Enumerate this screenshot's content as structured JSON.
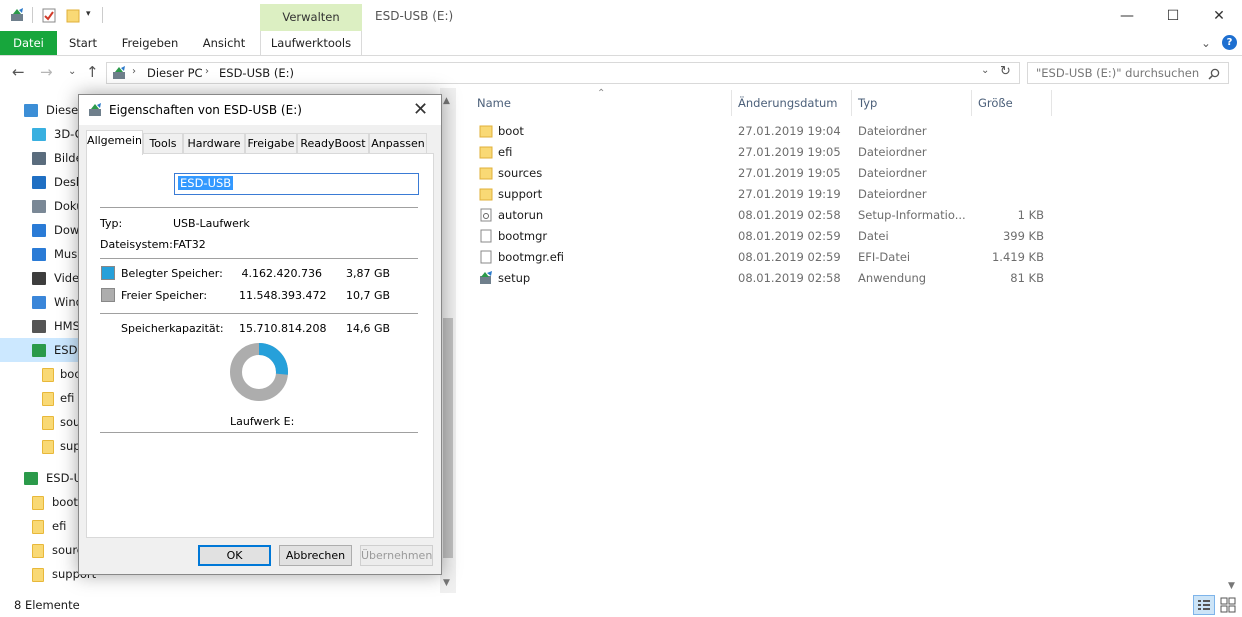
{
  "window": {
    "title": "ESD-USB (E:)",
    "context_tab": "Verwalten",
    "minimize": "—",
    "maximize": "☐",
    "close": "✕"
  },
  "ribbon": {
    "tabs": [
      "Datei",
      "Start",
      "Freigeben",
      "Ansicht",
      "Laufwerktools"
    ],
    "collapse": "⌄",
    "help": "?"
  },
  "address": {
    "path": [
      "Dieser PC",
      "ESD-USB (E:)"
    ],
    "search_placeholder": "\"ESD-USB (E:)\" durchsuchen"
  },
  "nav": {
    "items": [
      {
        "label": "Dieser",
        "icon": "pc-icon"
      },
      {
        "label": "3D-O",
        "icon": "3d-objects-icon"
      },
      {
        "label": "Bilde",
        "icon": "pictures-icon"
      },
      {
        "label": "Desk",
        "icon": "desktop-icon"
      },
      {
        "label": "Doku",
        "icon": "documents-icon"
      },
      {
        "label": "Dow",
        "icon": "downloads-icon"
      },
      {
        "label": "Musi",
        "icon": "music-icon"
      },
      {
        "label": "Vide",
        "icon": "videos-icon"
      },
      {
        "label": "Wind",
        "icon": "windows-drive-icon"
      },
      {
        "label": "HMS",
        "icon": "drive-icon"
      },
      {
        "label": "ESD-",
        "icon": "usb-drive-icon"
      },
      {
        "label": "boo",
        "icon": "folder-icon"
      },
      {
        "label": "efi",
        "icon": "folder-icon"
      },
      {
        "label": "sou",
        "icon": "folder-icon"
      },
      {
        "label": "sup",
        "icon": "folder-icon"
      },
      {
        "label": "ESD-U",
        "icon": "usb-drive-icon"
      },
      {
        "label": "boot",
        "icon": "folder-icon"
      },
      {
        "label": "efi",
        "icon": "folder-icon"
      },
      {
        "label": "sourc",
        "icon": "folder-icon"
      },
      {
        "label": "support",
        "icon": "folder-icon"
      }
    ]
  },
  "filelist": {
    "columns": [
      "Name",
      "Änderungsdatum",
      "Typ",
      "Größe"
    ],
    "rows": [
      {
        "name": "boot",
        "date": "27.01.2019 19:04",
        "type": "Dateiordner",
        "size": "",
        "icon": "folder-icon"
      },
      {
        "name": "efi",
        "date": "27.01.2019 19:05",
        "type": "Dateiordner",
        "size": "",
        "icon": "folder-icon"
      },
      {
        "name": "sources",
        "date": "27.01.2019 19:05",
        "type": "Dateiordner",
        "size": "",
        "icon": "folder-icon"
      },
      {
        "name": "support",
        "date": "27.01.2019 19:19",
        "type": "Dateiordner",
        "size": "",
        "icon": "folder-icon"
      },
      {
        "name": "autorun",
        "date": "08.01.2019 02:58",
        "type": "Setup-Informatio...",
        "size": "1 KB",
        "icon": "settings-file-icon"
      },
      {
        "name": "bootmgr",
        "date": "08.01.2019 02:59",
        "type": "Datei",
        "size": "399 KB",
        "icon": "file-icon"
      },
      {
        "name": "bootmgr.efi",
        "date": "08.01.2019 02:59",
        "type": "EFI-Datei",
        "size": "1.419 KB",
        "icon": "file-icon"
      },
      {
        "name": "setup",
        "date": "08.01.2019 02:58",
        "type": "Anwendung",
        "size": "81 KB",
        "icon": "setup-app-icon"
      }
    ]
  },
  "status": {
    "count": "8 Elemente"
  },
  "dialog": {
    "title": "Eigenschaften von ESD-USB (E:)",
    "tabs": [
      "Allgemein",
      "Tools",
      "Hardware",
      "Freigabe",
      "ReadyBoost",
      "Anpassen"
    ],
    "name_value": "ESD-USB",
    "type_label": "Typ:",
    "type_value": "USB-Laufwerk",
    "fs_label": "Dateisystem:",
    "fs_value": "FAT32",
    "used_label": "Belegter Speicher:",
    "used_bytes": "4.162.420.736",
    "used_gb": "3,87 GB",
    "free_label": "Freier Speicher:",
    "free_bytes": "11.548.393.472",
    "free_gb": "10,7 GB",
    "cap_label": "Speicherkapazität:",
    "cap_bytes": "15.710.814.208",
    "cap_gb": "14,6 GB",
    "drive_label": "Laufwerk E:",
    "ok": "OK",
    "cancel": "Abbrechen",
    "apply": "Übernehmen",
    "used_color": "#26a0da",
    "free_color": "#adadad"
  }
}
